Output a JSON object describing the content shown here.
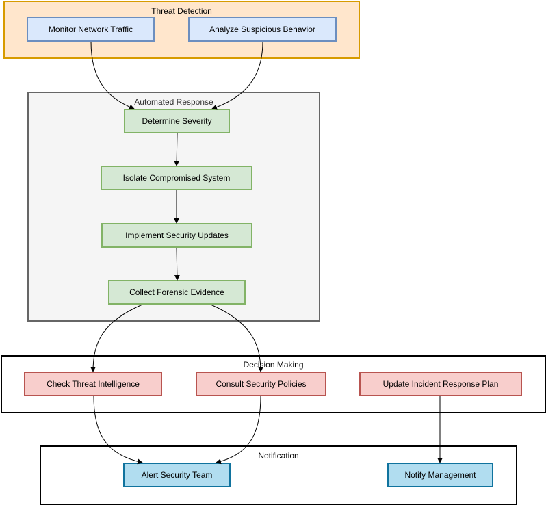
{
  "groups": {
    "threat_detection": {
      "label": "Threat Detection",
      "fill": "#ffe6cc",
      "stroke": "#d79b00"
    },
    "automated_response": {
      "label": "Automated Response",
      "fill": "#f5f5f5",
      "stroke": "#666666"
    },
    "decision_making": {
      "label": "Decision Making",
      "fill": "#ffffff",
      "stroke": "#000000"
    },
    "notification": {
      "label": "Notification",
      "fill": "#ffffff",
      "stroke": "#000000"
    }
  },
  "nodes": {
    "monitor": "Monitor Network Traffic",
    "analyze": "Analyze Suspicious Behavior",
    "severity": "Determine Severity",
    "isolate": "Isolate Compromised System",
    "updates": "Implement Security Updates",
    "evidence": "Collect Forensic Evidence",
    "intel": "Check Threat Intelligence",
    "policies": "Consult Security Policies",
    "plan": "Update Incident Response Plan",
    "alert": "Alert Security Team",
    "notify": "Notify Management"
  },
  "edges": [
    [
      "monitor",
      "severity"
    ],
    [
      "analyze",
      "severity"
    ],
    [
      "severity",
      "isolate"
    ],
    [
      "isolate",
      "updates"
    ],
    [
      "updates",
      "evidence"
    ],
    [
      "evidence",
      "intel"
    ],
    [
      "evidence",
      "policies"
    ],
    [
      "intel",
      "alert"
    ],
    [
      "policies",
      "alert"
    ],
    [
      "plan",
      "notify"
    ]
  ]
}
